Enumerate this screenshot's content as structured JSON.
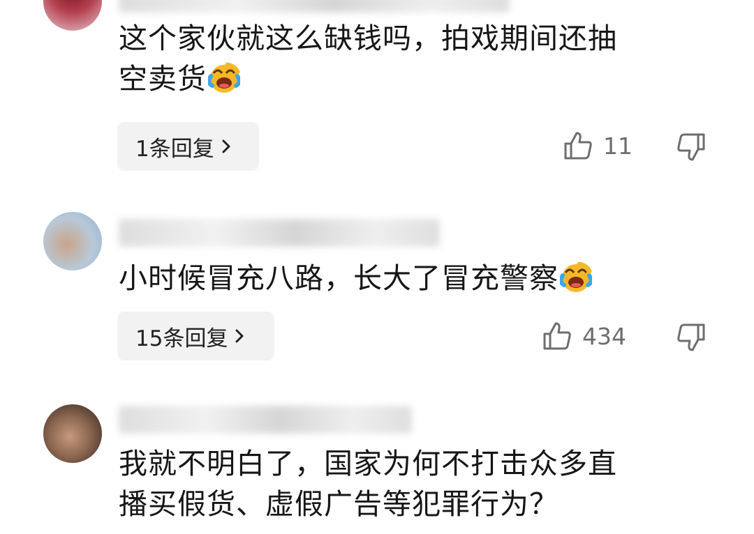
{
  "comments": [
    {
      "text_line1": "这个家伙就这么缺钱吗，拍戏期间还抽",
      "text_line2": "空卖货",
      "emoji": "laughing-crying-emoji",
      "replies_label": "1条回复",
      "likes": "11"
    },
    {
      "text_line1": "小时候冒充八路，长大了冒充警察",
      "emoji": "laughing-crying-emoji",
      "replies_label": "15条回复",
      "likes": "434"
    },
    {
      "text_line1": "我就不明白了，国家为何不打击众多直",
      "text_line2": "播买假货、虚假广告等犯罪行为？"
    }
  ],
  "icons": {
    "like": "thumbs-up-outline-icon",
    "dislike": "thumbs-down-outline-icon",
    "reply_chevron": "chevron-right-icon"
  },
  "colors": {
    "text": "#161616",
    "muted": "#6d6d6d",
    "reply_bg": "#f2f2f2",
    "emoji": "#f5b828"
  }
}
